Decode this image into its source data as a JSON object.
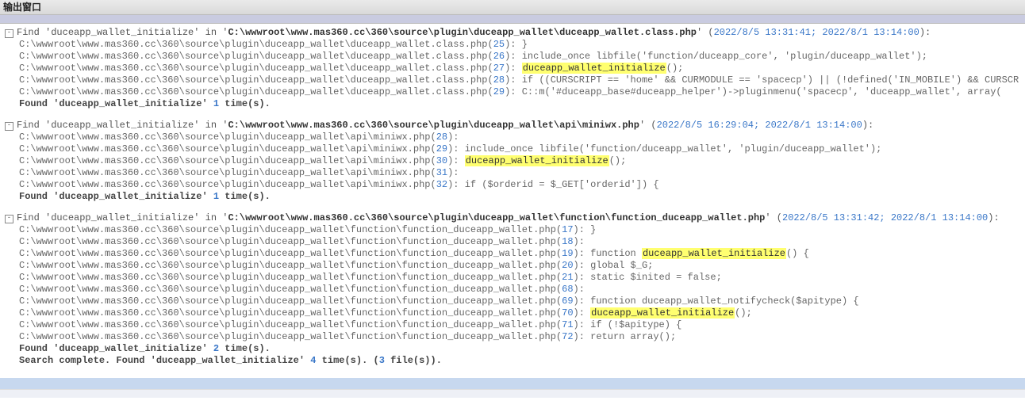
{
  "window": {
    "title": "输出窗口"
  },
  "search_term": "duceapp_wallet_initialize",
  "total_summary": {
    "prefix": "Search complete. Found '",
    "term": "duceapp_wallet_initialize",
    "mid1": "' ",
    "count": "4",
    "mid2": " time(s). (",
    "files": "3",
    "suffix": " file(s))."
  },
  "blocks": [
    {
      "find_prefix": "Find '",
      "find_mid": "' in '",
      "path": "C:\\wwwroot\\www.mas360.cc\\360\\source\\plugin\\duceapp_wallet\\duceapp_wallet.class.php",
      "find_suffix": "' (",
      "ts": "2022/8/5 13:31:41; 2022/8/1 13:14:00",
      "close": "):",
      "lines": [
        {
          "path": "C:\\wwwroot\\www.mas360.cc\\360\\source\\plugin\\duceapp_wallet\\duceapp_wallet.class.php",
          "ln": "25",
          "code_before": "   }",
          "hl": "",
          "code_after": ""
        },
        {
          "path": "C:\\wwwroot\\www.mas360.cc\\360\\source\\plugin\\duceapp_wallet\\duceapp_wallet.class.php",
          "ln": "26",
          "code_before": "   include_once libfile('function/duceapp_core', 'plugin/duceapp_wallet');",
          "hl": "",
          "code_after": ""
        },
        {
          "path": "C:\\wwwroot\\www.mas360.cc\\360\\source\\plugin\\duceapp_wallet\\duceapp_wallet.class.php",
          "ln": "27",
          "code_before": "   ",
          "hl": "duceapp_wallet_initialize",
          "code_after": "();"
        },
        {
          "path": "C:\\wwwroot\\www.mas360.cc\\360\\source\\plugin\\duceapp_wallet\\duceapp_wallet.class.php",
          "ln": "28",
          "code_before": "   if ((CURSCRIPT == 'home' && CURMODULE == 'spacecp') || (!defined('IN_MOBILE') && CURSCR",
          "hl": "",
          "code_after": ""
        },
        {
          "path": "C:\\wwwroot\\www.mas360.cc\\360\\source\\plugin\\duceapp_wallet\\duceapp_wallet.class.php",
          "ln": "29",
          "code_before": "    C::m('#duceapp_base#duceapp_helper')->pluginmenu('spacecp', 'duceapp_wallet', array(",
          "hl": "",
          "code_after": ""
        }
      ],
      "found": {
        "prefix": "Found '",
        "term": "duceapp_wallet_initialize",
        "mid": "' ",
        "count": "1",
        "suffix": " time(s)."
      }
    },
    {
      "find_prefix": "Find '",
      "find_mid": "' in '",
      "path": "C:\\wwwroot\\www.mas360.cc\\360\\source\\plugin\\duceapp_wallet\\api\\miniwx.php",
      "find_suffix": "' (",
      "ts": "2022/8/5 16:29:04; 2022/8/1 13:14:00",
      "close": "):",
      "lines": [
        {
          "path": "C:\\wwwroot\\www.mas360.cc\\360\\source\\plugin\\duceapp_wallet\\api\\miniwx.php",
          "ln": "28",
          "code_before": "",
          "hl": "",
          "code_after": ""
        },
        {
          "path": "C:\\wwwroot\\www.mas360.cc\\360\\source\\plugin\\duceapp_wallet\\api\\miniwx.php",
          "ln": "29",
          "code_before": " include_once libfile('function/duceapp_wallet', 'plugin/duceapp_wallet');",
          "hl": "",
          "code_after": ""
        },
        {
          "path": "C:\\wwwroot\\www.mas360.cc\\360\\source\\plugin\\duceapp_wallet\\api\\miniwx.php",
          "ln": "30",
          "code_before": " ",
          "hl": "duceapp_wallet_initialize",
          "code_after": "();"
        },
        {
          "path": "C:\\wwwroot\\www.mas360.cc\\360\\source\\plugin\\duceapp_wallet\\api\\miniwx.php",
          "ln": "31",
          "code_before": "",
          "hl": "",
          "code_after": ""
        },
        {
          "path": "C:\\wwwroot\\www.mas360.cc\\360\\source\\plugin\\duceapp_wallet\\api\\miniwx.php",
          "ln": "32",
          "code_before": " if ($orderid = $_GET['orderid']) {",
          "hl": "",
          "code_after": ""
        }
      ],
      "found": {
        "prefix": "Found '",
        "term": "duceapp_wallet_initialize",
        "mid": "' ",
        "count": "1",
        "suffix": " time(s)."
      }
    },
    {
      "find_prefix": "Find '",
      "find_mid": "' in '",
      "path": "C:\\wwwroot\\www.mas360.cc\\360\\source\\plugin\\duceapp_wallet\\function\\function_duceapp_wallet.php",
      "find_suffix": "' (",
      "ts": "2022/8/5 13:31:42; 2022/8/1 13:14:00",
      "close": "):",
      "lines": [
        {
          "path": "C:\\wwwroot\\www.mas360.cc\\360\\source\\plugin\\duceapp_wallet\\function\\function_duceapp_wallet.php",
          "ln": "17",
          "code_before": " }",
          "hl": "",
          "code_after": ""
        },
        {
          "path": "C:\\wwwroot\\www.mas360.cc\\360\\source\\plugin\\duceapp_wallet\\function\\function_duceapp_wallet.php",
          "ln": "18",
          "code_before": "",
          "hl": "",
          "code_after": ""
        },
        {
          "path": "C:\\wwwroot\\www.mas360.cc\\360\\source\\plugin\\duceapp_wallet\\function\\function_duceapp_wallet.php",
          "ln": "19",
          "code_before": " function ",
          "hl": "duceapp_wallet_initialize",
          "code_after": "() {"
        },
        {
          "path": "C:\\wwwroot\\www.mas360.cc\\360\\source\\plugin\\duceapp_wallet\\function\\function_duceapp_wallet.php",
          "ln": "20",
          "code_before": "  global $_G;",
          "hl": "",
          "code_after": ""
        },
        {
          "path": "C:\\wwwroot\\www.mas360.cc\\360\\source\\plugin\\duceapp_wallet\\function\\function_duceapp_wallet.php",
          "ln": "21",
          "code_before": "  static $inited = false;",
          "hl": "",
          "code_after": ""
        },
        {
          "path": "C:\\wwwroot\\www.mas360.cc\\360\\source\\plugin\\duceapp_wallet\\function\\function_duceapp_wallet.php",
          "ln": "68",
          "code_before": "",
          "hl": "",
          "code_after": ""
        },
        {
          "path": "C:\\wwwroot\\www.mas360.cc\\360\\source\\plugin\\duceapp_wallet\\function\\function_duceapp_wallet.php",
          "ln": "69",
          "code_before": " function duceapp_wallet_notifycheck($apitype) {",
          "hl": "",
          "code_after": ""
        },
        {
          "path": "C:\\wwwroot\\www.mas360.cc\\360\\source\\plugin\\duceapp_wallet\\function\\function_duceapp_wallet.php",
          "ln": "70",
          "code_before": "  ",
          "hl": "duceapp_wallet_initialize",
          "code_after": "();"
        },
        {
          "path": "C:\\wwwroot\\www.mas360.cc\\360\\source\\plugin\\duceapp_wallet\\function\\function_duceapp_wallet.php",
          "ln": "71",
          "code_before": "  if (!$apitype) {",
          "hl": "",
          "code_after": ""
        },
        {
          "path": "C:\\wwwroot\\www.mas360.cc\\360\\source\\plugin\\duceapp_wallet\\function\\function_duceapp_wallet.php",
          "ln": "72",
          "code_before": "   return array();",
          "hl": "",
          "code_after": ""
        }
      ],
      "found": {
        "prefix": "Found '",
        "term": "duceapp_wallet_initialize",
        "mid": "' ",
        "count": "2",
        "suffix": " time(s)."
      }
    }
  ]
}
